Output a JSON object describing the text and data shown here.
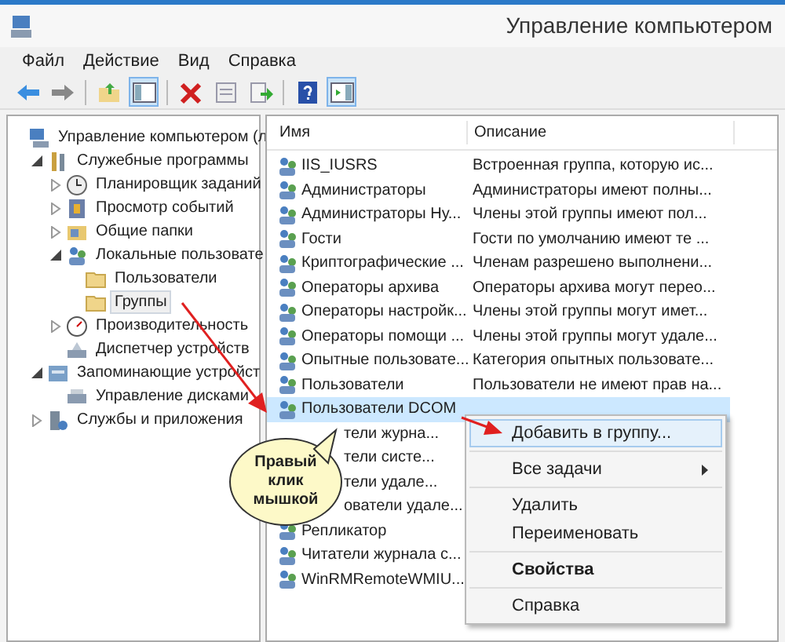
{
  "window": {
    "title": "Управление компьютером"
  },
  "menu_bar": [
    "Файл",
    "Действие",
    "Вид",
    "Справка"
  ],
  "toolbar": [
    {
      "kind": "back",
      "pressed": false
    },
    {
      "kind": "forward",
      "pressed": false
    },
    {
      "kind": "separator"
    },
    {
      "kind": "up",
      "pressed": false
    },
    {
      "kind": "tree",
      "pressed": true
    },
    {
      "kind": "separator"
    },
    {
      "kind": "delete",
      "pressed": false
    },
    {
      "kind": "properties",
      "pressed": false
    },
    {
      "kind": "export",
      "pressed": false
    },
    {
      "kind": "separator"
    },
    {
      "kind": "help",
      "pressed": false
    },
    {
      "kind": "actions",
      "pressed": true
    }
  ],
  "tree": [
    {
      "label": "Управление компьютером (л",
      "kind": "computer",
      "selected": false,
      "children": [
        {
          "label": "Служебные программы",
          "kind": "tools",
          "expanded": true,
          "selected": false,
          "children": [
            {
              "label": "Планировщик заданий",
              "kind": "clock",
              "expanded": false,
              "selected": false
            },
            {
              "label": "Просмотр событий",
              "kind": "log",
              "expanded": false,
              "selected": false
            },
            {
              "label": "Общие папки",
              "kind": "share",
              "expanded": false,
              "selected": false
            },
            {
              "label": "Локальные пользовате",
              "kind": "users",
              "expanded": true,
              "selected": false,
              "children": [
                {
                  "label": "Пользователи",
                  "kind": "folder",
                  "selected": false
                },
                {
                  "label": "Группы",
                  "kind": "folder",
                  "selected": true
                }
              ]
            },
            {
              "label": "Производительность",
              "kind": "gauge",
              "expanded": false,
              "selected": false
            },
            {
              "label": "Диспетчер устройств",
              "kind": "devices",
              "selected": false
            }
          ]
        },
        {
          "label": "Запоминающие устройст",
          "kind": "storage",
          "expanded": true,
          "selected": false,
          "children": [
            {
              "label": "Управление дисками",
              "kind": "disk",
              "selected": false
            }
          ]
        },
        {
          "label": "Службы и приложения",
          "kind": "services",
          "expanded": false,
          "selected": false
        }
      ]
    }
  ],
  "table": {
    "columns": [
      "Имя",
      "Описание"
    ],
    "rows": [
      {
        "kind": "group",
        "name": "IIS_IUSRS",
        "description": "Встроенная группа, которую ис...",
        "selected": false
      },
      {
        "kind": "group",
        "name": "Администраторы",
        "description": "Администраторы имеют полны...",
        "selected": false
      },
      {
        "kind": "group",
        "name": "Администраторы Ну...",
        "description": "Члены этой группы имеют пол...",
        "selected": false
      },
      {
        "kind": "group",
        "name": "Гости",
        "description": "Гости по умолчанию имеют те ...",
        "selected": false
      },
      {
        "kind": "group",
        "name": "Криптографические ...",
        "description": "Членам разрешено выполнени...",
        "selected": false
      },
      {
        "kind": "group",
        "name": "Операторы архива",
        "description": "Операторы архива могут перео...",
        "selected": false
      },
      {
        "kind": "group",
        "name": "Операторы настройк...",
        "description": "Члены этой группы могут имет...",
        "selected": false
      },
      {
        "kind": "group",
        "name": "Операторы помощи ...",
        "description": "Члены этой группы могут удале...",
        "selected": false
      },
      {
        "kind": "group",
        "name": "Опытные пользовате...",
        "description": "Категория опытных пользовате...",
        "selected": false
      },
      {
        "kind": "group",
        "name": "Пользователи",
        "description": "Пользователи не имеют прав на...",
        "selected": false
      },
      {
        "kind": "group",
        "name": "Пользователи DCOM",
        "selected": true
      },
      {
        "kind": "covered",
        "name": "тели журна...",
        "selected": false
      },
      {
        "kind": "covered",
        "name": "тели систе...",
        "selected": false
      },
      {
        "kind": "covered",
        "name": "тели удале...",
        "selected": false
      },
      {
        "kind": "covered",
        "name": "ователи удале...",
        "selected": false
      },
      {
        "kind": "group",
        "name": "Репликатор",
        "selected": false
      },
      {
        "kind": "group",
        "name": "Читатели журнала с...",
        "selected": false
      },
      {
        "kind": "group",
        "name": "WinRMRemoteWMIU...",
        "selected": false
      }
    ]
  },
  "context_menu": [
    {
      "kind": "item",
      "label": "Добавить в группу...",
      "highlighted": true
    },
    {
      "kind": "separator"
    },
    {
      "kind": "submenu",
      "label": "Все задачи",
      "highlighted": false
    },
    {
      "kind": "separator"
    },
    {
      "kind": "item",
      "label": "Удалить",
      "highlighted": false
    },
    {
      "kind": "item",
      "label": "Переименовать",
      "highlighted": false
    },
    {
      "kind": "separator"
    },
    {
      "kind": "default",
      "label": "Свойства",
      "highlighted": false
    },
    {
      "kind": "separator"
    },
    {
      "kind": "item",
      "label": "Справка",
      "highlighted": false
    }
  ],
  "callout": {
    "text": "Правый клик мышкой"
  }
}
